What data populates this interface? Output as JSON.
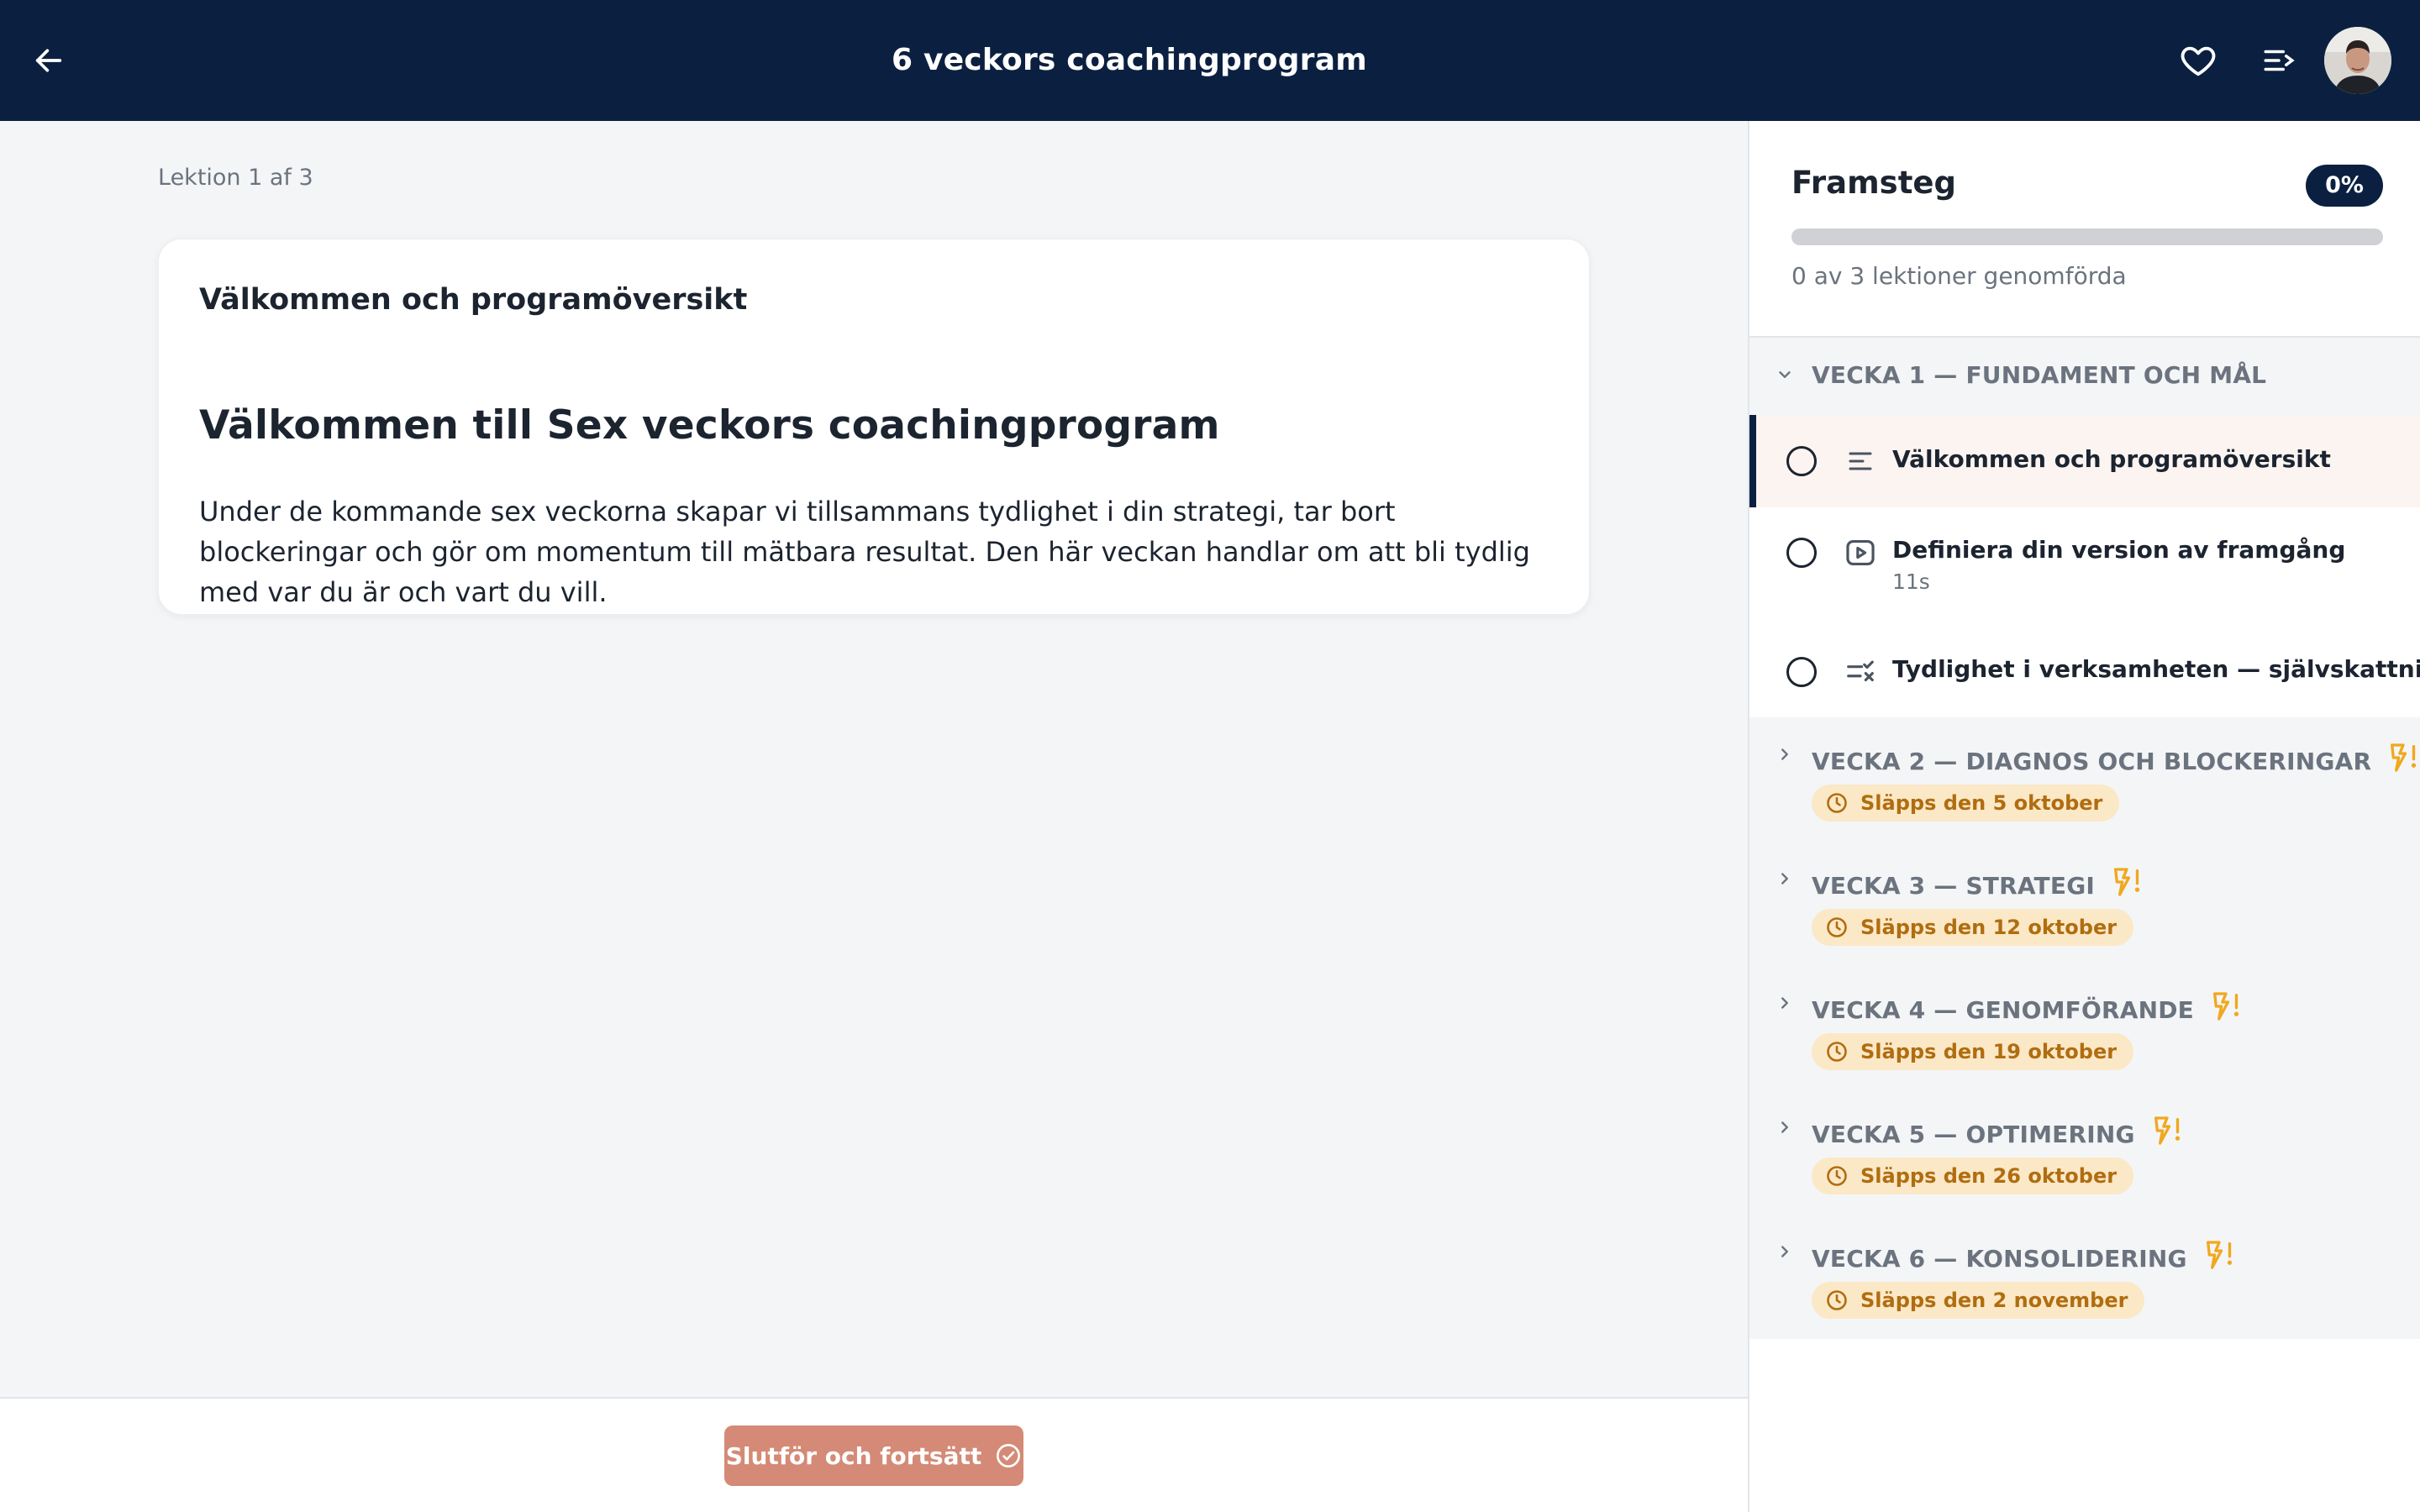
{
  "header": {
    "title": "6 veckors coachingprogram",
    "icons": {
      "back": "arrow-left-icon",
      "favorite": "heart-icon",
      "outline": "list-outline-icon",
      "avatar": "user-avatar"
    }
  },
  "main": {
    "lesson_counter": "Lektion 1 af 3",
    "card": {
      "title": "Välkommen och programöversikt",
      "heading": "Välkommen till Sex veckors coachingprogram",
      "body": "Under de kommande sex veckorna skapar vi tillsammans tydlighet i din strategi, tar bort blockeringar och gör om momentum till mätbara resultat. Den här veckan handlar om att bli tydlig med var du är och vart du vill."
    }
  },
  "footer": {
    "complete_button": "Slutför och fortsätt"
  },
  "sidebar": {
    "progress": {
      "title": "Framsteg",
      "percent_label": "0%",
      "percent_value": 0,
      "caption": "0 av 3 lektioner genomförda"
    },
    "modules": [
      {
        "title": "VECKA 1 — FUNDAMENT OCH MÅL",
        "expanded": true,
        "lessons": [
          {
            "title": "Välkommen och programöversikt",
            "subtitle": "",
            "type_icon": "text-lines-icon",
            "active": true
          },
          {
            "title": "Definiera din version av framgång",
            "subtitle": "11s",
            "type_icon": "video-play-icon",
            "active": false
          },
          {
            "title": "Tydlighet i verksamheten — självskattning",
            "subtitle": "",
            "type_icon": "checklist-icon",
            "active": false
          }
        ]
      },
      {
        "title": "VECKA 2 — DIAGNOS OCH BLOCKERINGAR",
        "expanded": false,
        "release": "Släpps den 5 oktober"
      },
      {
        "title": "VECKA 3 — STRATEGI",
        "expanded": false,
        "release": "Släpps den 12 oktober"
      },
      {
        "title": "VECKA 4 — GENOMFÖRANDE",
        "expanded": false,
        "release": "Släpps den 19 oktober"
      },
      {
        "title": "VECKA 5 — OPTIMERING",
        "expanded": false,
        "release": "Släpps den 26 oktober"
      },
      {
        "title": "VECKA 6 — KONSOLIDERING",
        "expanded": false,
        "release": "Släpps den 2 november"
      }
    ],
    "colors": {
      "navy": "#0b2040",
      "release_bg": "#fbe8c6",
      "release_text": "#b06d10",
      "bolt": "#f0a81e",
      "button": "#d48a76"
    }
  }
}
